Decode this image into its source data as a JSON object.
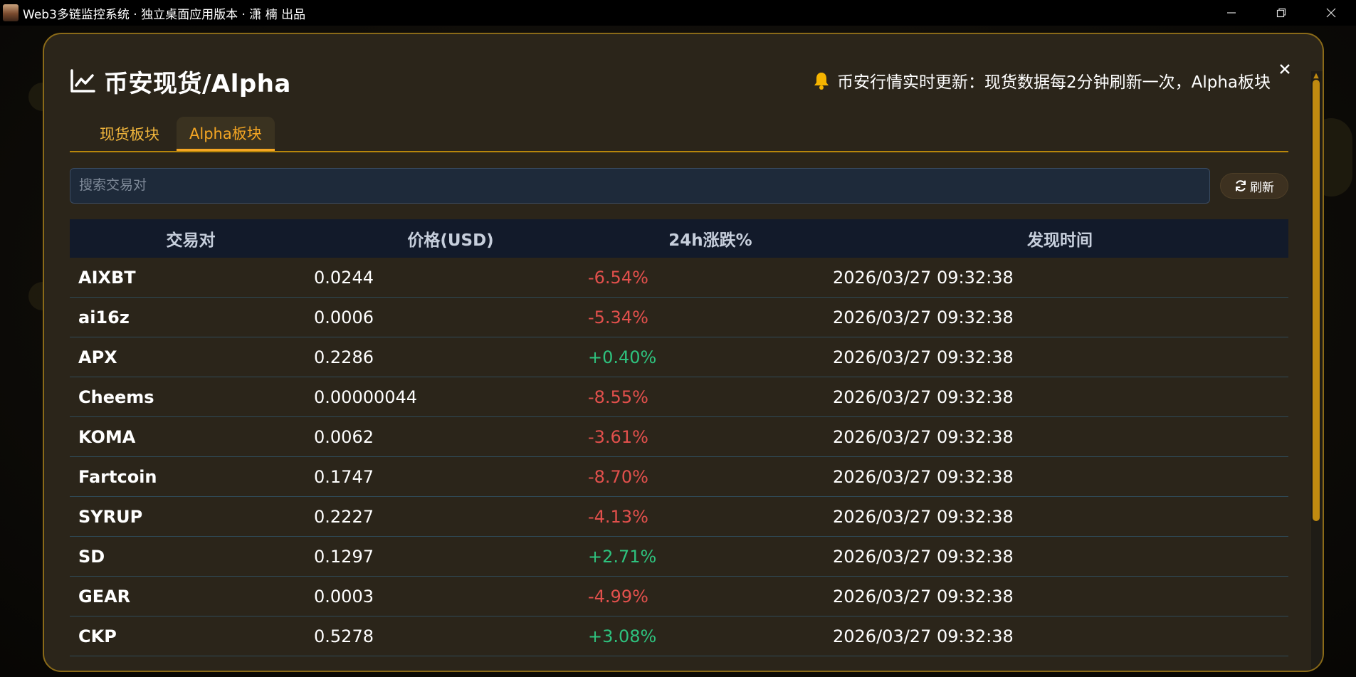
{
  "window": {
    "title": "Web3多链监控系统 · 独立桌面应用版本 · 潇 楠 出品"
  },
  "modal": {
    "title": "币安现货/Alpha",
    "ticker": "币安行情实时更新：现货数据每2分钟刷新一次，Alpha板块"
  },
  "tabs": [
    {
      "label": "现货板块",
      "active": false
    },
    {
      "label": "Alpha板块",
      "active": true
    }
  ],
  "search": {
    "placeholder": "搜索交易对",
    "value": ""
  },
  "refresh_label": "刷新",
  "table": {
    "headers": [
      "交易对",
      "价格(USD)",
      "24h涨跌%",
      "发现时间"
    ],
    "rows": [
      {
        "pair": "AIXBT",
        "price": "0.0244",
        "change": "-6.54%",
        "time": "2026/03/27 09:32:38"
      },
      {
        "pair": "ai16z",
        "price": "0.0006",
        "change": "-5.34%",
        "time": "2026/03/27 09:32:38"
      },
      {
        "pair": "APX",
        "price": "0.2286",
        "change": "+0.40%",
        "time": "2026/03/27 09:32:38"
      },
      {
        "pair": "Cheems",
        "price": "0.00000044",
        "change": "-8.55%",
        "time": "2026/03/27 09:32:38"
      },
      {
        "pair": "KOMA",
        "price": "0.0062",
        "change": "-3.61%",
        "time": "2026/03/27 09:32:38"
      },
      {
        "pair": "Fartcoin",
        "price": "0.1747",
        "change": "-8.70%",
        "time": "2026/03/27 09:32:38"
      },
      {
        "pair": "SYRUP",
        "price": "0.2227",
        "change": "-4.13%",
        "time": "2026/03/27 09:32:38"
      },
      {
        "pair": "SD",
        "price": "0.1297",
        "change": "+2.71%",
        "time": "2026/03/27 09:32:38"
      },
      {
        "pair": "GEAR",
        "price": "0.0003",
        "change": "-4.99%",
        "time": "2026/03/27 09:32:38"
      },
      {
        "pair": "CKP",
        "price": "0.5278",
        "change": "+3.08%",
        "time": "2026/03/27 09:32:38"
      }
    ]
  },
  "colors": {
    "accent": "#f5a623",
    "negative": "#e2504c",
    "positive": "#2ec27e",
    "modal_bg": "#2b251a",
    "header_bg": "#121a2a"
  }
}
